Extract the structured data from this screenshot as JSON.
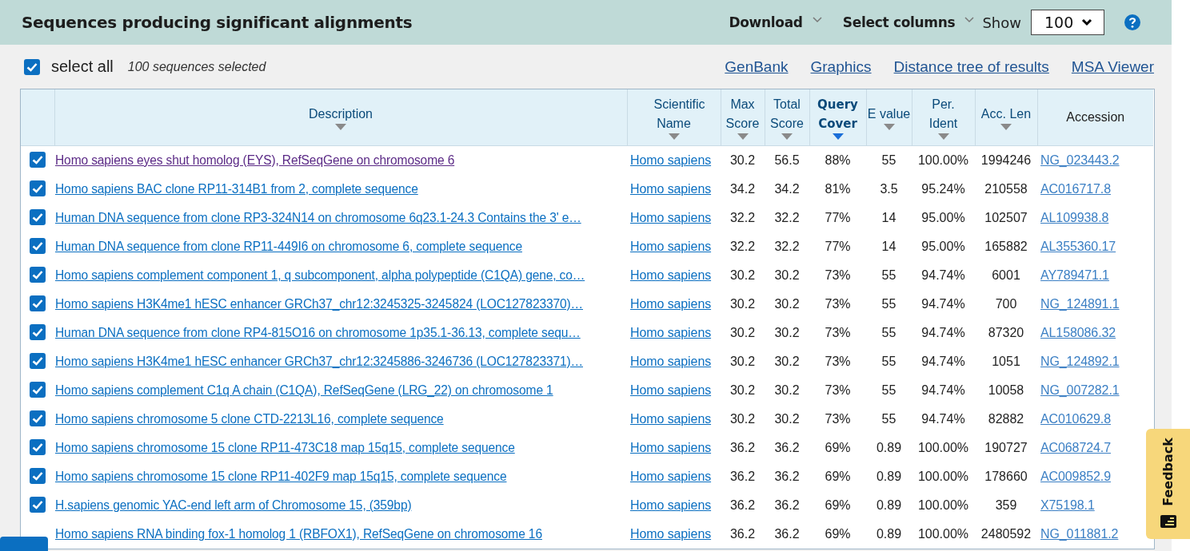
{
  "header": {
    "title": "Sequences producing significant alignments",
    "menus": [
      {
        "label": "Download"
      },
      {
        "label": "Select columns"
      }
    ],
    "show": {
      "label": "Show",
      "value": "100"
    }
  },
  "toolbar": {
    "select_all": {
      "label": "select all",
      "checked": true
    },
    "count": "100 sequences selected",
    "links": [
      "GenBank",
      "Graphics",
      "Distance tree of results",
      "MSA Viewer"
    ]
  },
  "table": {
    "columns": [
      {
        "label": "Description",
        "sorted": false,
        "arrow": true
      },
      {
        "label": "Scientific Name",
        "sorted": false,
        "arrow": true
      },
      {
        "label": "Max Score",
        "sorted": false,
        "arrow": true
      },
      {
        "label": "Total Score",
        "sorted": false,
        "arrow": true
      },
      {
        "label": "Query Cover",
        "sorted": true,
        "arrow": true
      },
      {
        "label": "E value",
        "sorted": false,
        "arrow": true
      },
      {
        "label": "Per. Ident",
        "sorted": false,
        "arrow": true
      },
      {
        "label": "Acc. Len",
        "sorted": false,
        "arrow": true
      },
      {
        "label": "Accession",
        "sorted": false,
        "arrow": false
      }
    ],
    "rows": [
      {
        "checked": true,
        "visited": true,
        "cells": [
          "Homo sapiens eyes shut homolog (EYS), RefSeqGene on chromosome 6",
          "Homo sapiens",
          "30.2",
          "56.5",
          "88%",
          "55",
          "100.00%",
          "1994246",
          "NG_023443.2"
        ]
      },
      {
        "checked": true,
        "visited": false,
        "cells": [
          "Homo sapiens BAC clone RP11-314B1 from 2, complete sequence",
          "Homo sapiens",
          "34.2",
          "34.2",
          "81%",
          "3.5",
          "95.24%",
          "210558",
          "AC016717.8"
        ]
      },
      {
        "checked": true,
        "visited": false,
        "cells": [
          "Human DNA sequence from clone RP3-324N14 on chromosome 6q23.1-24.3 Contains the 3' e…",
          "Homo sapiens",
          "32.2",
          "32.2",
          "77%",
          "14",
          "95.00%",
          "102507",
          "AL109938.8"
        ]
      },
      {
        "checked": true,
        "visited": false,
        "cells": [
          "Human DNA sequence from clone RP11-449I6 on chromosome 6, complete sequence",
          "Homo sapiens",
          "32.2",
          "32.2",
          "77%",
          "14",
          "95.00%",
          "165882",
          "AL355360.17"
        ]
      },
      {
        "checked": true,
        "visited": false,
        "cells": [
          "Homo sapiens complement component 1, q subcomponent, alpha polypeptide (C1QA) gene, co…",
          "Homo sapiens",
          "30.2",
          "30.2",
          "73%",
          "55",
          "94.74%",
          "6001",
          "AY789471.1"
        ]
      },
      {
        "checked": true,
        "visited": false,
        "cells": [
          "Homo sapiens H3K4me1 hESC enhancer GRCh37_chr12:3245325-3245824 (LOC127823370)…",
          "Homo sapiens",
          "30.2",
          "30.2",
          "73%",
          "55",
          "94.74%",
          "700",
          "NG_124891.1"
        ]
      },
      {
        "checked": true,
        "visited": false,
        "cells": [
          "Human DNA sequence from clone RP4-815O16 on chromosome 1p35.1-36.13, complete sequ…",
          "Homo sapiens",
          "30.2",
          "30.2",
          "73%",
          "55",
          "94.74%",
          "87320",
          "AL158086.32"
        ]
      },
      {
        "checked": true,
        "visited": false,
        "cells": [
          "Homo sapiens H3K4me1 hESC enhancer GRCh37_chr12:3245886-3246736 (LOC127823371)…",
          "Homo sapiens",
          "30.2",
          "30.2",
          "73%",
          "55",
          "94.74%",
          "1051",
          "NG_124892.1"
        ]
      },
      {
        "checked": true,
        "visited": false,
        "cells": [
          "Homo sapiens complement C1q A chain (C1QA), RefSeqGene (LRG_22) on chromosome 1",
          "Homo sapiens",
          "30.2",
          "30.2",
          "73%",
          "55",
          "94.74%",
          "10058",
          "NG_007282.1"
        ]
      },
      {
        "checked": true,
        "visited": false,
        "cells": [
          "Homo sapiens chromosome 5 clone CTD-2213L16, complete sequence",
          "Homo sapiens",
          "30.2",
          "30.2",
          "73%",
          "55",
          "94.74%",
          "82882",
          "AC010629.8"
        ]
      },
      {
        "checked": true,
        "visited": false,
        "cells": [
          "Homo sapiens chromosome 15 clone RP11-473C18 map 15q15, complete sequence",
          "Homo sapiens",
          "36.2",
          "36.2",
          "69%",
          "0.89",
          "100.00%",
          "190727",
          "AC068724.7"
        ]
      },
      {
        "checked": true,
        "visited": false,
        "cells": [
          "Homo sapiens chromosome 15 clone RP11-402F9 map 15q15, complete sequence",
          "Homo sapiens",
          "36.2",
          "36.2",
          "69%",
          "0.89",
          "100.00%",
          "178660",
          "AC009852.9"
        ]
      },
      {
        "checked": true,
        "visited": false,
        "cells": [
          "H.sapiens genomic YAC-end left arm of Chromosome 15, (359bp)",
          "Homo sapiens",
          "36.2",
          "36.2",
          "69%",
          "0.89",
          "100.00%",
          "359",
          "X75198.1"
        ]
      },
      {
        "visited": false,
        "cells": [
          "Homo sapiens RNA binding fox-1 homolog 1 (RBFOX1), RefSeqGene on chromosome 16",
          "Homo sapiens",
          "36.2",
          "36.2",
          "69%",
          "0.89",
          "100.00%",
          "2480592",
          "NG_011881.2"
        ]
      }
    ]
  },
  "feedback": {
    "label": "Feedback"
  }
}
